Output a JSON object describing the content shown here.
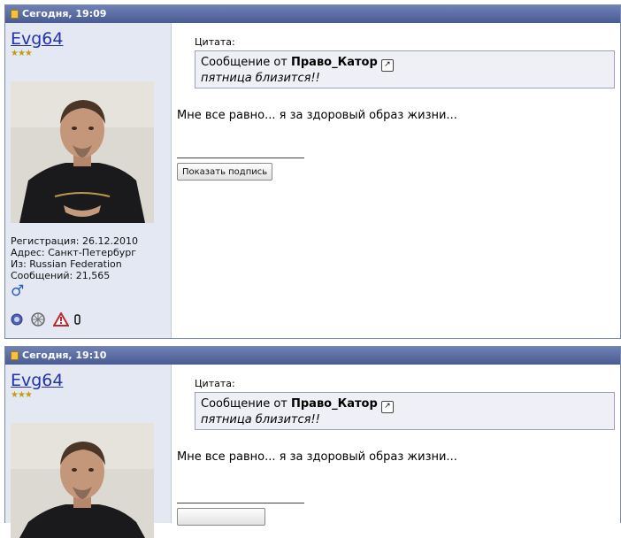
{
  "posts": [
    {
      "timestamp": "Сегодня, 19:09",
      "username": "Evg64",
      "stars": "★★★",
      "registration": "Регистрация: 26.12.2010",
      "address": "Адрес: Санкт-Петербург",
      "from": "Из: Russian Federation",
      "messages": "Сообщений: 21,565",
      "gender_symbol": "♂",
      "quote_label": "Цитата:",
      "quote_prefix": "Сообщение от",
      "quote_author": "Право_Катор",
      "quote_text": "пятница близится!!",
      "message": "Мне все равно... я за здоровый образ жизни...",
      "signature_button": "Показать подпись"
    },
    {
      "timestamp": "Сегодня, 19:10",
      "username": "Evg64",
      "stars": "★★★",
      "quote_label": "Цитата:",
      "quote_prefix": "Сообщение от",
      "quote_author": "Право_Катор",
      "quote_text": "пятница близится!!",
      "message": "Мне все равно... я за здоровый образ жизни..."
    }
  ]
}
